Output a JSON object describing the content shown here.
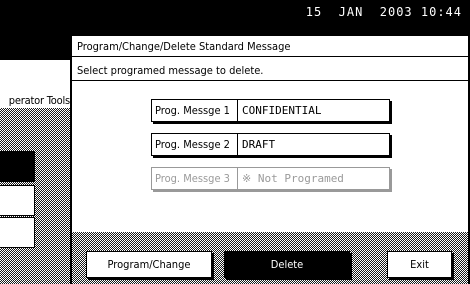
{
  "header": {
    "datetime": "15  JAN  2003 10:44"
  },
  "sidebar": {
    "label": "perator Tools"
  },
  "dialog": {
    "title": "Program/Change/Delete Standard Message",
    "instruction": "Select programed message to delete.",
    "messages": [
      {
        "name": "Prog. Messge 1",
        "value": "CONFIDENTIAL"
      },
      {
        "name": "Prog. Messge 2",
        "value": "DRAFT"
      },
      {
        "name": "Prog. Messge 3",
        "value": "※ Not Programed"
      }
    ]
  },
  "footer": {
    "program_change": "Program/Change",
    "delete": "Delete",
    "exit": "Exit"
  }
}
